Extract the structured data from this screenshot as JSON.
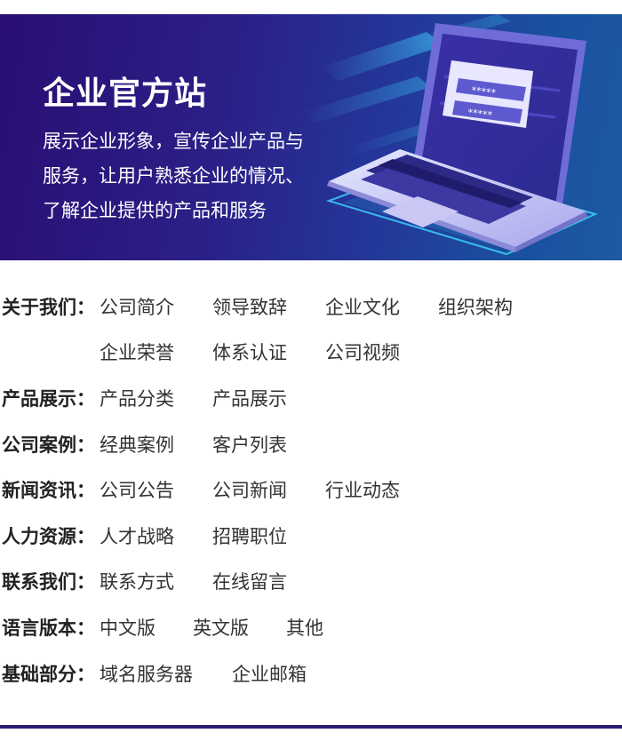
{
  "banner": {
    "title": "企业官方站",
    "desc_lines": [
      "展示企业形象，宣传企业产品与",
      "服务，让用户熟悉企业的情况、",
      "了解企业提供的产品和服务"
    ],
    "password_mask": "*****"
  },
  "nav": [
    {
      "label": "关于我们：",
      "links": [
        "公司简介",
        "领导致辞",
        "企业文化",
        "组织架构",
        "企业荣誉",
        "体系认证",
        "公司视频"
      ]
    },
    {
      "label": "产品展示：",
      "links": [
        "产品分类",
        "产品展示"
      ]
    },
    {
      "label": "公司案例：",
      "links": [
        "经典案例",
        "客户列表"
      ]
    },
    {
      "label": "新闻资讯：",
      "links": [
        "公司公告",
        "公司新闻",
        "行业动态"
      ]
    },
    {
      "label": "人力资源：",
      "links": [
        "人才战略",
        "招聘职位"
      ]
    },
    {
      "label": "联系我们：",
      "links": [
        "联系方式",
        "在线留言"
      ]
    },
    {
      "label": "语言版本：",
      "links": [
        "中文版",
        "英文版",
        "其他"
      ]
    },
    {
      "label": "基础部分：",
      "links": [
        "域名服务器",
        "企业邮箱"
      ]
    }
  ],
  "colors": {
    "banner_start": "#2a0e74",
    "banner_end": "#1d5aa2",
    "bottom_line": "#2b1b73"
  }
}
